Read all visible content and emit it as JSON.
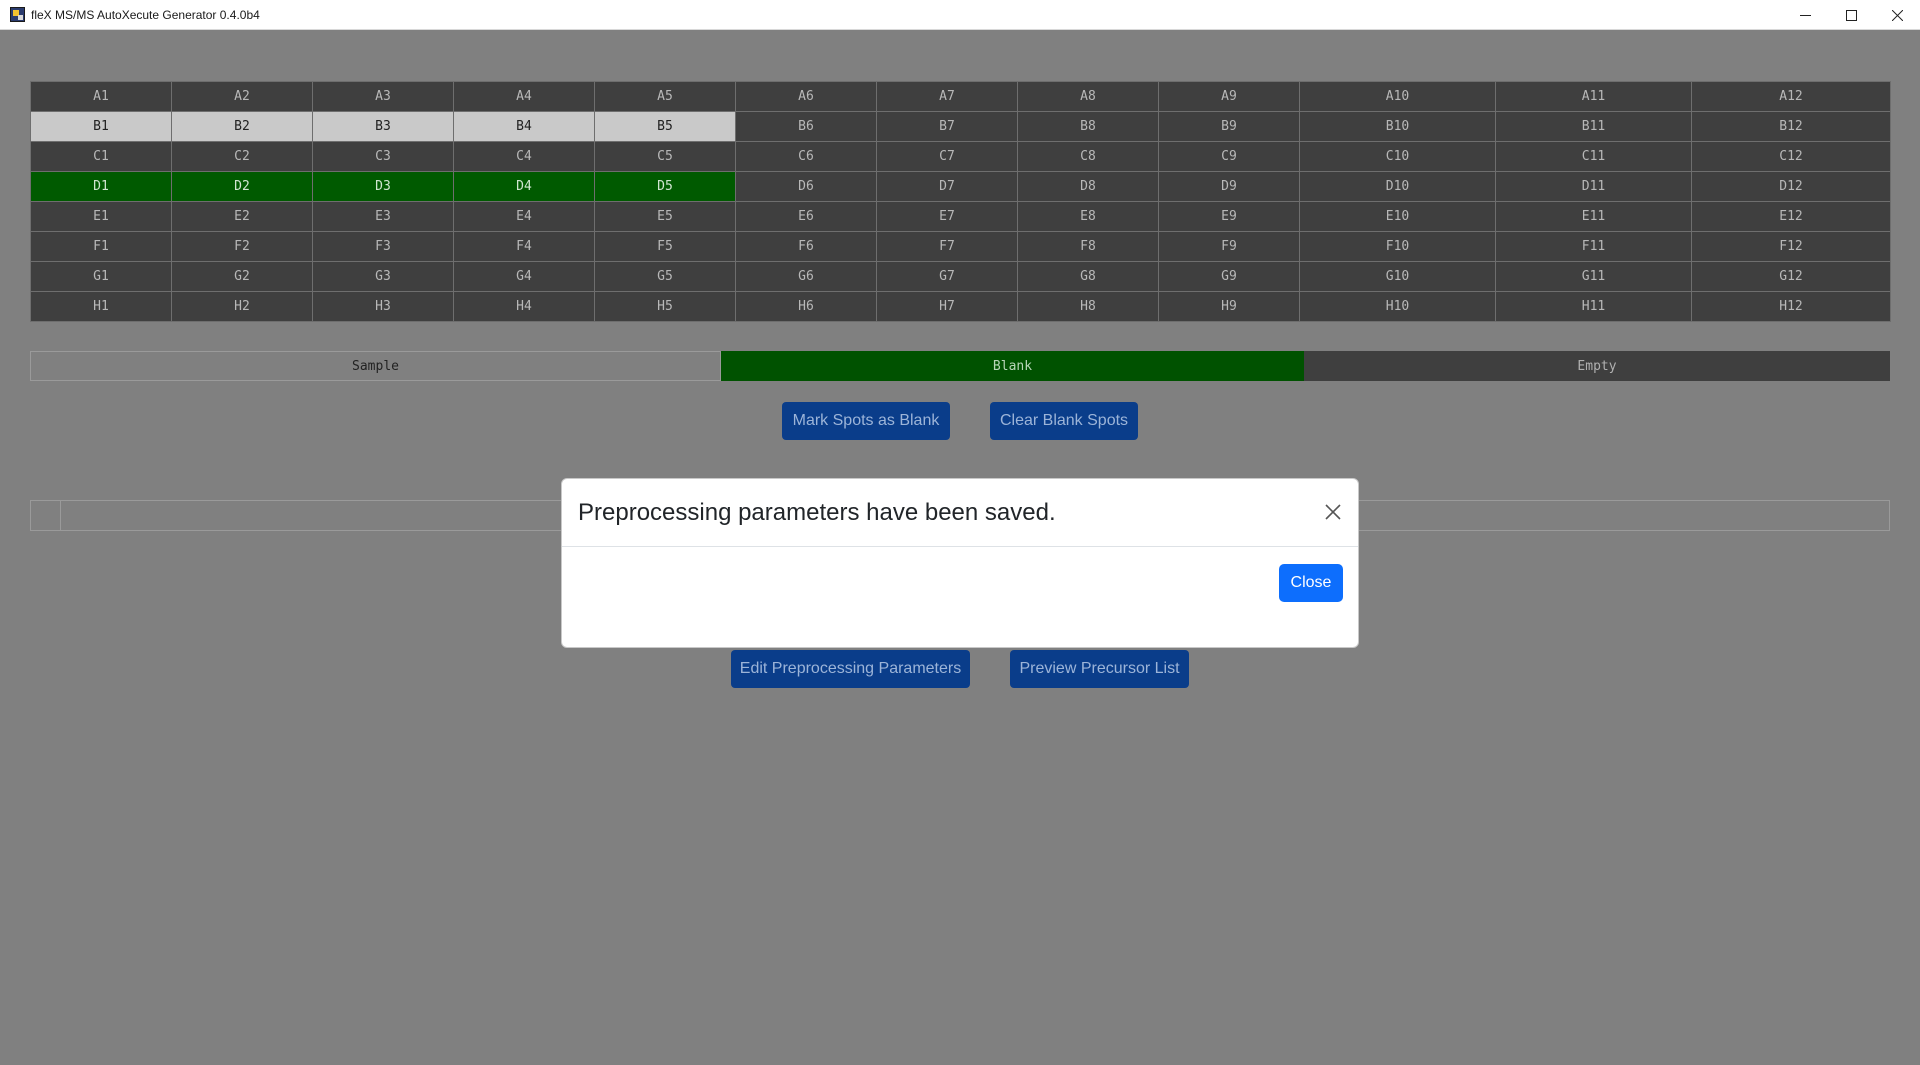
{
  "window": {
    "title": "fleX MS/MS AutoXecute Generator 0.4.0b4"
  },
  "plate": {
    "rows": [
      {
        "cells": [
          {
            "label": "A1",
            "state": "empty"
          },
          {
            "label": "A2",
            "state": "empty"
          },
          {
            "label": "A3",
            "state": "empty"
          },
          {
            "label": "A4",
            "state": "empty"
          },
          {
            "label": "A5",
            "state": "empty"
          },
          {
            "label": "A6",
            "state": "empty"
          },
          {
            "label": "A7",
            "state": "empty"
          },
          {
            "label": "A8",
            "state": "empty"
          },
          {
            "label": "A9",
            "state": "empty"
          },
          {
            "label": "A10",
            "state": "empty"
          },
          {
            "label": "A11",
            "state": "empty"
          },
          {
            "label": "A12",
            "state": "empty"
          }
        ]
      },
      {
        "cells": [
          {
            "label": "B1",
            "state": "sample"
          },
          {
            "label": "B2",
            "state": "sample"
          },
          {
            "label": "B3",
            "state": "sample"
          },
          {
            "label": "B4",
            "state": "sample"
          },
          {
            "label": "B5",
            "state": "sample"
          },
          {
            "label": "B6",
            "state": "empty"
          },
          {
            "label": "B7",
            "state": "empty"
          },
          {
            "label": "B8",
            "state": "empty"
          },
          {
            "label": "B9",
            "state": "empty"
          },
          {
            "label": "B10",
            "state": "empty"
          },
          {
            "label": "B11",
            "state": "empty"
          },
          {
            "label": "B12",
            "state": "empty"
          }
        ]
      },
      {
        "cells": [
          {
            "label": "C1",
            "state": "empty"
          },
          {
            "label": "C2",
            "state": "empty"
          },
          {
            "label": "C3",
            "state": "empty"
          },
          {
            "label": "C4",
            "state": "empty"
          },
          {
            "label": "C5",
            "state": "empty"
          },
          {
            "label": "C6",
            "state": "empty"
          },
          {
            "label": "C7",
            "state": "empty"
          },
          {
            "label": "C8",
            "state": "empty"
          },
          {
            "label": "C9",
            "state": "empty"
          },
          {
            "label": "C10",
            "state": "empty"
          },
          {
            "label": "C11",
            "state": "empty"
          },
          {
            "label": "C12",
            "state": "empty"
          }
        ]
      },
      {
        "cells": [
          {
            "label": "D1",
            "state": "blank"
          },
          {
            "label": "D2",
            "state": "blank"
          },
          {
            "label": "D3",
            "state": "blank"
          },
          {
            "label": "D4",
            "state": "blank"
          },
          {
            "label": "D5",
            "state": "blank"
          },
          {
            "label": "D6",
            "state": "empty"
          },
          {
            "label": "D7",
            "state": "empty"
          },
          {
            "label": "D8",
            "state": "empty"
          },
          {
            "label": "D9",
            "state": "empty"
          },
          {
            "label": "D10",
            "state": "empty"
          },
          {
            "label": "D11",
            "state": "empty"
          },
          {
            "label": "D12",
            "state": "empty"
          }
        ]
      },
      {
        "cells": [
          {
            "label": "E1",
            "state": "empty"
          },
          {
            "label": "E2",
            "state": "empty"
          },
          {
            "label": "E3",
            "state": "empty"
          },
          {
            "label": "E4",
            "state": "empty"
          },
          {
            "label": "E5",
            "state": "empty"
          },
          {
            "label": "E6",
            "state": "empty"
          },
          {
            "label": "E7",
            "state": "empty"
          },
          {
            "label": "E8",
            "state": "empty"
          },
          {
            "label": "E9",
            "state": "empty"
          },
          {
            "label": "E10",
            "state": "empty"
          },
          {
            "label": "E11",
            "state": "empty"
          },
          {
            "label": "E12",
            "state": "empty"
          }
        ]
      },
      {
        "cells": [
          {
            "label": "F1",
            "state": "empty"
          },
          {
            "label": "F2",
            "state": "empty"
          },
          {
            "label": "F3",
            "state": "empty"
          },
          {
            "label": "F4",
            "state": "empty"
          },
          {
            "label": "F5",
            "state": "empty"
          },
          {
            "label": "F6",
            "state": "empty"
          },
          {
            "label": "F7",
            "state": "empty"
          },
          {
            "label": "F8",
            "state": "empty"
          },
          {
            "label": "F9",
            "state": "empty"
          },
          {
            "label": "F10",
            "state": "empty"
          },
          {
            "label": "F11",
            "state": "empty"
          },
          {
            "label": "F12",
            "state": "empty"
          }
        ]
      },
      {
        "cells": [
          {
            "label": "G1",
            "state": "empty"
          },
          {
            "label": "G2",
            "state": "empty"
          },
          {
            "label": "G3",
            "state": "empty"
          },
          {
            "label": "G4",
            "state": "empty"
          },
          {
            "label": "G5",
            "state": "empty"
          },
          {
            "label": "G6",
            "state": "empty"
          },
          {
            "label": "G7",
            "state": "empty"
          },
          {
            "label": "G8",
            "state": "empty"
          },
          {
            "label": "G9",
            "state": "empty"
          },
          {
            "label": "G10",
            "state": "empty"
          },
          {
            "label": "G11",
            "state": "empty"
          },
          {
            "label": "G12",
            "state": "empty"
          }
        ]
      },
      {
        "cells": [
          {
            "label": "H1",
            "state": "empty"
          },
          {
            "label": "H2",
            "state": "empty"
          },
          {
            "label": "H3",
            "state": "empty"
          },
          {
            "label": "H4",
            "state": "empty"
          },
          {
            "label": "H5",
            "state": "empty"
          },
          {
            "label": "H6",
            "state": "empty"
          },
          {
            "label": "H7",
            "state": "empty"
          },
          {
            "label": "H8",
            "state": "empty"
          },
          {
            "label": "H9",
            "state": "empty"
          },
          {
            "label": "H10",
            "state": "empty"
          },
          {
            "label": "H11",
            "state": "empty"
          },
          {
            "label": "H12",
            "state": "empty"
          }
        ]
      }
    ]
  },
  "legend": {
    "sample": "Sample",
    "blank": "Blank",
    "empty": "Empty"
  },
  "buttons": {
    "mark_blank": "Mark Spots as Blank",
    "clear_blank": "Clear Blank Spots",
    "edit_preprocessing": "Edit Preprocessing Parameters",
    "preview_precursor": "Preview Precursor List"
  },
  "modal": {
    "title": "Preprocessing parameters have been saved.",
    "close_button": "Close"
  },
  "colors": {
    "sample": "#c9c9c9",
    "blank": "#005a00",
    "empty": "#3f3f3f",
    "primary_button": "#0d6efd",
    "overlay_button": "#0a3d8a"
  },
  "icons": {
    "app": "app-icon",
    "minimize": "minimize-icon",
    "maximize": "maximize-icon",
    "close": "close-icon",
    "modal_close": "close-icon"
  }
}
